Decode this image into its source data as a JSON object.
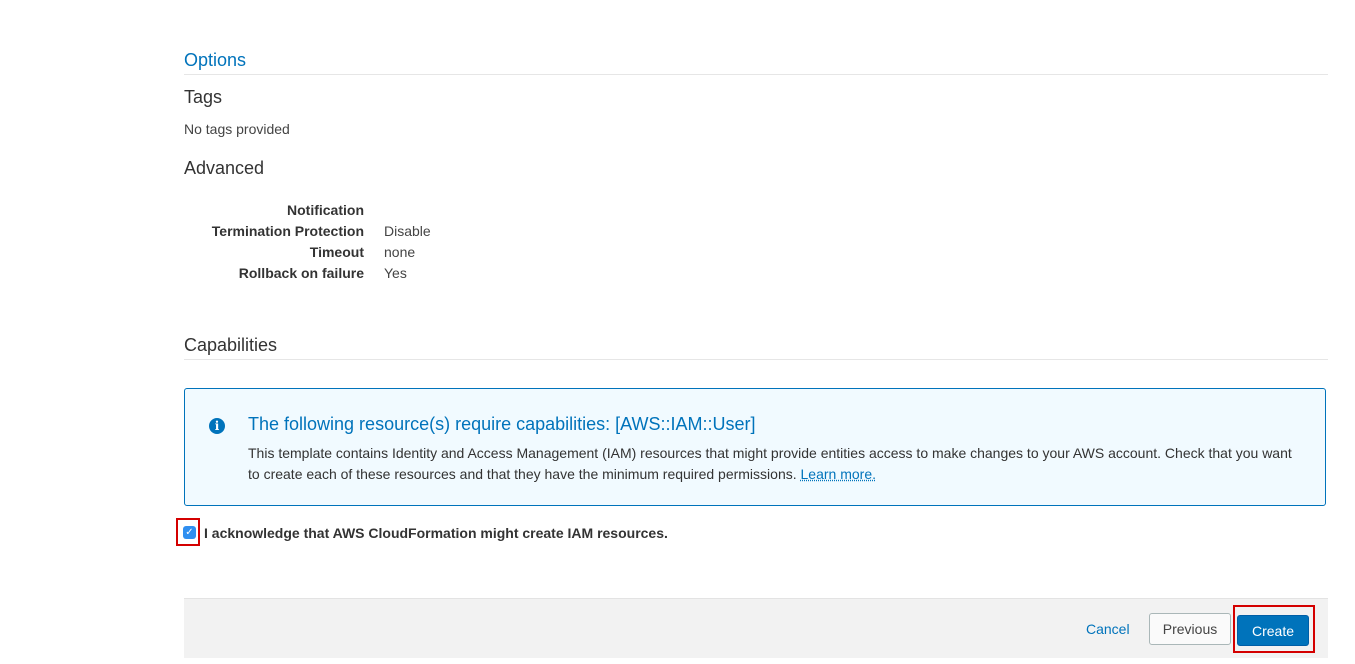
{
  "options": {
    "title": "Options"
  },
  "tags": {
    "heading": "Tags",
    "empty_text": "No tags provided"
  },
  "advanced": {
    "heading": "Advanced",
    "rows": [
      {
        "key": "Notification",
        "value": ""
      },
      {
        "key": "Termination Protection",
        "value": "Disable"
      },
      {
        "key": "Timeout",
        "value": "none"
      },
      {
        "key": "Rollback on failure",
        "value": "Yes"
      }
    ]
  },
  "capabilities": {
    "heading": "Capabilities",
    "info": {
      "icon": "info-icon",
      "title": "The following resource(s) require capabilities: [AWS::IAM::User]",
      "body": "This template contains Identity and Access Management (IAM) resources that might provide entities access to make changes to your AWS account. Check that you want to create each of these resources and that they have the minimum required permissions.",
      "link": "Learn more."
    },
    "acknowledge": {
      "label": "I acknowledge that AWS CloudFormation might create IAM resources.",
      "checked": true
    }
  },
  "footer": {
    "cancel": "Cancel",
    "previous": "Previous",
    "create": "Create"
  },
  "colors": {
    "accent": "#0073bb",
    "info_bg": "#f1faff",
    "highlight": "#d40000"
  }
}
